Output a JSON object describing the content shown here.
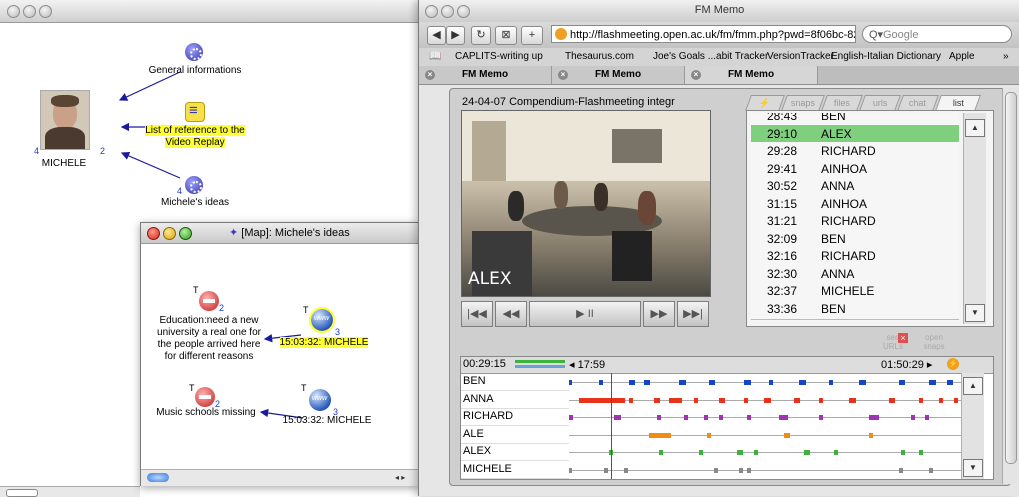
{
  "compendium": {
    "nodes": {
      "general": {
        "label": "General informations"
      },
      "reference": {
        "label_line1": "List of reference to the",
        "label_line2": "Video Replay"
      },
      "ideas": {
        "label": "Michele's ideas",
        "count": "4"
      },
      "michele": {
        "label": "MICHELE",
        "count_left": "4",
        "count_right": "2"
      }
    }
  },
  "map_window": {
    "title": "[Map]: Michele's ideas",
    "nodes": {
      "education": {
        "tag": "T",
        "count": "2",
        "lines": [
          "Education:need a new",
          "university a real one for",
          "the people arrived here",
          "for different reasons"
        ]
      },
      "link1": {
        "tag": "T",
        "count": "3",
        "label": "15:03:32: MICHELE"
      },
      "music": {
        "tag": "T",
        "count": "2",
        "label": "Music schools missing"
      },
      "link2": {
        "tag": "T",
        "count": "3",
        "label": "15:03:32: MICHELE"
      }
    }
  },
  "browser": {
    "title": "FM Memo",
    "url": "http://flashmeeting.open.ac.uk/fm/fmm.php?pwd=8f06bc-82",
    "search_placeholder": "Google",
    "bookmarks": [
      "CAPLITS-writing up",
      "Thesaurus.com",
      "Joe's Goals ...abit Tracker",
      "VersionTracker",
      "English-Italian Dictionary",
      "Apple"
    ],
    "bookmarks_more": "»",
    "tabs": [
      "FM Memo",
      "FM Memo",
      "FM Memo"
    ],
    "video_title": "24-04-07  Compendium-Flashmeeting integr",
    "video_caption": "ALEX",
    "right_tabs": [
      "⚡",
      "snaps",
      "files",
      "urls",
      "chat",
      "list"
    ],
    "list": [
      {
        "time": "28:43",
        "name": "BEN"
      },
      {
        "time": "29:10",
        "name": "ALEX",
        "selected": true
      },
      {
        "time": "29:28",
        "name": "RICHARD"
      },
      {
        "time": "29:41",
        "name": "AINHOA"
      },
      {
        "time": "30:52",
        "name": "ANNA"
      },
      {
        "time": "31:15",
        "name": "AINHOA"
      },
      {
        "time": "31:21",
        "name": "RICHARD"
      },
      {
        "time": "32:09",
        "name": "BEN"
      },
      {
        "time": "32:16",
        "name": "RICHARD"
      },
      {
        "time": "32:30",
        "name": "ANNA"
      },
      {
        "time": "32:37",
        "name": "MICHELE"
      },
      {
        "time": "33:36",
        "name": "BEN"
      }
    ],
    "see_urls": [
      "see",
      "URLs"
    ],
    "open_snaps": [
      "open",
      "snaps"
    ],
    "timeline": {
      "current": "00:29:15",
      "marker": "◂ 17:59",
      "end": "01:50:29 ▸",
      "participants": [
        "BEN",
        "ANNA",
        "RICHARD",
        "ALE",
        "ALEX",
        "MICHELE"
      ],
      "colors": {
        "BEN": "#1844c8",
        "ANNA": "#e8321a",
        "RICHARD": "#a032b4",
        "ALE": "#f08c14",
        "ALEX": "#3cb43c",
        "MICHELE": "#888888"
      }
    }
  }
}
